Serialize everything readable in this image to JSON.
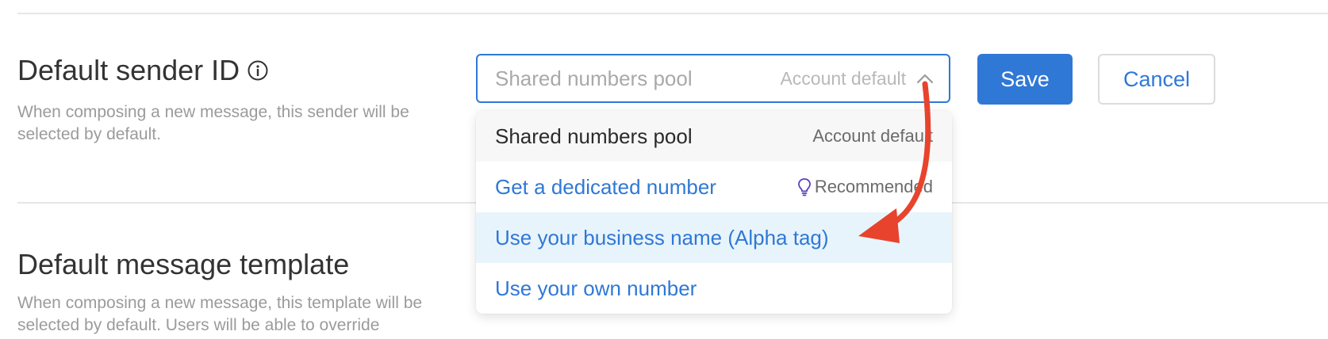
{
  "sections": [
    {
      "title": "Default sender ID",
      "description": "When composing a new message, this sender will be selected by default.",
      "info_icon": "info-circle-icon"
    },
    {
      "title": "Default message template",
      "description": "When composing a new message, this template will be selected by default. Users will be able to override"
    }
  ],
  "sender_select": {
    "placeholder": "Shared numbers pool",
    "value": "",
    "hint": "Account default",
    "chevron_icon": "chevron-up-icon",
    "options": [
      {
        "label": "Shared numbers pool",
        "meta": "Account default",
        "state": "selected"
      },
      {
        "label": "Get a dedicated number",
        "meta": "Recommended",
        "meta_icon": "lightbulb-icon"
      },
      {
        "label": "Use your business name (Alpha tag)",
        "state": "highlighted"
      },
      {
        "label": "Use your own number"
      }
    ]
  },
  "actions": {
    "save_label": "Save",
    "cancel_label": "Cancel"
  },
  "colors": {
    "accent": "#2f78d6",
    "annotation_arrow": "#e8432d",
    "highlight_row": "#e8f4fb",
    "bulb_icon": "#5b3fc4"
  }
}
